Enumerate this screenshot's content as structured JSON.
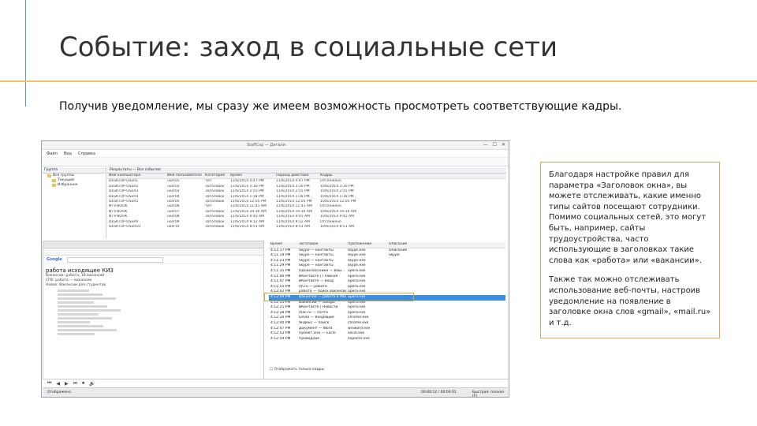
{
  "slide": {
    "title": "Событие: заход в социальные сети",
    "subtitle": "Получив уведомление, мы сразу же имеем возможность просмотреть соответствующие кадры.",
    "callout_p1": "Благодаря настройке правил для параметра «Заголовок окна», вы можете отслеживать, какие именно типы сайтов посещают сотрудники. Помимо социальных сетей, это могут быть, например, сайты трудоустройства, часто использующие в заголовках такие слова как «работа» или «вакансии».",
    "callout_p2": "Также так можно отслеживать использование веб-почты, настроив уведомление на появление в заголовке окна слов «gmail», «mail.ru» и т.д."
  },
  "window": {
    "title": "StaffCop — Детали",
    "controls": [
      "—",
      "☐",
      "✕"
    ],
    "menu": [
      "Файл",
      "Вид",
      "Справка"
    ],
    "tree_header": "Группа",
    "tree_items": [
      "Все группы",
      "Текущий",
      "Избранное"
    ],
    "events_header": "Результаты — Все события",
    "event_columns": [
      "Имя компьютера",
      "Имя пользователя",
      "Категория",
      "Время",
      "Период действия",
      "Кадры"
    ],
    "event_rows": [
      [
        "DESKTOP-USER1",
        "user01",
        "Чат",
        "11/6/2014 4:47 PM",
        "11/6/2014 4:47 PM",
        "Отслежено"
      ],
      [
        "DESKTOP-USER2",
        "user02",
        "Заголовок",
        "11/6/2014 3:16 PM",
        "11/6/2014 3:16 PM",
        "10/6/2014 3:16 PM"
      ],
      [
        "DESKTOP-USER3",
        "user03",
        "Заголовок",
        "11/6/2014 2:55 PM",
        "11/6/2014 2:55 PM",
        "10/6/2014 2:55 PM"
      ],
      [
        "DESKTOP-USER4",
        "user04",
        "Заголовок",
        "11/6/2014 1:18 PM",
        "11/6/2014 1:18 PM",
        "10/6/2014 1:18 PM"
      ],
      [
        "DESKTOP-USER5",
        "user05",
        "Заголовок",
        "11/6/2014 12:05 PM",
        "11/6/2014 12:05 PM",
        "10/6/2014 12:05 PM"
      ],
      [
        "NTV-BOOK",
        "user06",
        "Чат",
        "11/6/2014 11:41 AM",
        "11/6/2014 11:41 AM",
        "Отслежено"
      ],
      [
        "NTV-BOOK",
        "user07",
        "Заголовок",
        "11/6/2014 10:30 AM",
        "11/6/2014 10:30 AM",
        "10/6/2014 10:30 AM"
      ],
      [
        "NTV-BOOK",
        "user08",
        "Заголовок",
        "11/6/2014 9:45 AM",
        "11/6/2014 9:45 AM",
        "10/6/2014 9:45 AM"
      ],
      [
        "DESKTOP-USER9",
        "user09",
        "Заголовок",
        "11/6/2014 9:12 AM",
        "11/6/2014 9:12 AM",
        "Отслежено"
      ],
      [
        "DESKTOP-USER10",
        "user10",
        "Заголовок",
        "11/6/2014 8:51 AM",
        "11/6/2014 8:51 AM",
        "10/6/2014 8:51 AM"
      ]
    ],
    "list_columns": [
      "Время",
      "Заголовок",
      "Приложение",
      "Описание"
    ],
    "list_rows": [
      [
        "4:11:17 PM",
        "Skype — контакты",
        "skype.exe",
        "Описание"
      ],
      [
        "4:11:19 PM",
        "Skype — контакты",
        "skype.exe",
        "Skype"
      ],
      [
        "4:11:23 PM",
        "Skype — контакты",
        "skype.exe",
        ""
      ],
      [
        "4:11:29 PM",
        "Skype — контакты",
        "skype.exe",
        ""
      ],
      [
        "4:11:35 PM",
        "Одноклассники — ваш...",
        "opera.exe",
        ""
      ],
      [
        "4:11:40 PM",
        "ВКонтакте | Главная",
        "opera.exe",
        ""
      ],
      [
        "4:11:47 PM",
        "ВКонтакте — вход",
        "opera.exe",
        ""
      ],
      [
        "4:11:55 PM",
        "hh.ru — работа",
        "opera.exe",
        ""
      ],
      [
        "4:12:02 PM",
        "работа — поиск вакансий",
        "opera.exe",
        ""
      ],
      [
        "4:12:09 PM",
        "Вакансии — работа в Москве",
        "opera.exe",
        ""
      ],
      [
        "4:12:15 PM",
        "Вакансии — Google",
        "opera.exe",
        ""
      ],
      [
        "4:12:21 PM",
        "ВКонтакте | Новости",
        "opera.exe",
        ""
      ],
      [
        "4:12:28 PM",
        "mail.ru — почта",
        "opera.exe",
        ""
      ],
      [
        "4:12:34 PM",
        "Gmail — Входящие",
        "chrome.exe",
        ""
      ],
      [
        "4:12:40 PM",
        "Яндекс — поиск",
        "chrome.exe",
        ""
      ],
      [
        "4:12:47 PM",
        "Документ — Word",
        "winword.exe",
        ""
      ],
      [
        "4:12:53 PM",
        "Проект.xlsx — Excel",
        "excel.exe",
        ""
      ],
      [
        "4:12:59 PM",
        "Проводник",
        "explorer.exe",
        ""
      ]
    ],
    "selected_row": 9,
    "list_checkbox": "Отображать только кадры",
    "browser_headline": "работа исходящее КИЗ",
    "browser_lines": [
      "Вакансии: работа, 18 вакансий",
      "СПб: работа — вакансии",
      "Новое: Вакансии для студентов"
    ],
    "media_icons": [
      "⏮",
      "◀",
      "▶",
      "⏭",
      "⏹",
      "🔊"
    ],
    "status_left": "Отображено",
    "status_mid": "00:00:12 / 00:04:01",
    "status_right": "Быстрая: полная (F)"
  }
}
